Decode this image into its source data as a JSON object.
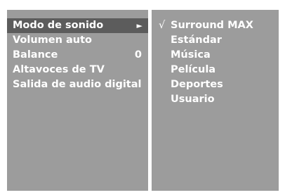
{
  "sound_menu": {
    "items": [
      {
        "label": "Modo de sonido",
        "arrow": "►",
        "value": ""
      },
      {
        "label": "Volumen auto",
        "arrow": "",
        "value": ""
      },
      {
        "label": "Balance",
        "arrow": "",
        "value": "0"
      },
      {
        "label": "Altavoces de TV",
        "arrow": "",
        "value": ""
      },
      {
        "label": "Salida de audio digital",
        "arrow": "",
        "value": ""
      }
    ],
    "selected_index": 0
  },
  "sound_mode_submenu": {
    "check_mark": "√",
    "options": [
      {
        "label": "Surround MAX",
        "checked": true
      },
      {
        "label": "Estándar",
        "checked": false
      },
      {
        "label": "Música",
        "checked": false
      },
      {
        "label": "Película",
        "checked": false
      },
      {
        "label": "Deportes",
        "checked": false
      },
      {
        "label": "Usuario",
        "checked": false
      }
    ]
  },
  "colors": {
    "panel": "#9c9c9c",
    "highlight": "#5c5c5c",
    "text": "#ffffff",
    "background": "#ffffff"
  }
}
